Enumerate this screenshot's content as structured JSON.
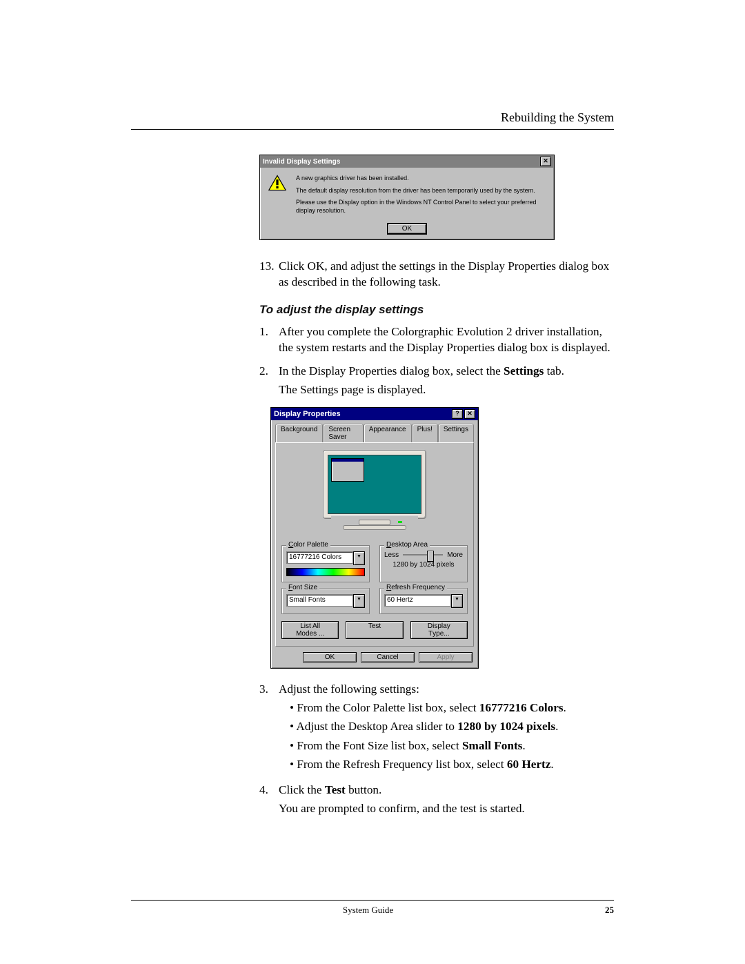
{
  "header": {
    "chapter": "Rebuilding the System"
  },
  "msgbox": {
    "title": "Invalid Display Settings",
    "line1": "A new graphics driver has been installed.",
    "line2": "The default display resolution from the driver has been temporarily used by the system.",
    "line3": "Please use the Display option in the Windows NT Control Panel to select your preferred display resolution.",
    "ok": "OK",
    "close": "✕"
  },
  "step13_num": "13.",
  "step13": "Click OK, and adjust the settings in the Display Properties dialog box as described in the following task.",
  "subhead": "To adjust the display settings",
  "step1_num": "1.",
  "step1": "After you complete the Colorgraphic Evolution 2 driver installation, the system restarts and the Display Properties dialog box is displayed.",
  "step2_num": "2.",
  "step2a": "In the Display Properties dialog box, select the ",
  "step2b": "Settings",
  "step2c": " tab.",
  "step2d": "The Settings page is displayed.",
  "dp": {
    "title": "Display Properties",
    "help": "?",
    "close": "✕",
    "tabs": {
      "background": "Background",
      "screensaver": "Screen Saver",
      "appearance": "Appearance",
      "plus": "Plus!",
      "settings": "Settings"
    },
    "color_palette_label": "Color Palette",
    "color_palette_label_ul": "C",
    "color_palette_value": "16777216 Colors",
    "desktop_area_label": "Desktop Area",
    "desktop_area_label_ul": "D",
    "less": "Less",
    "more": "More",
    "resolution": "1280 by 1024 pixels",
    "font_size_label": "Font Size",
    "font_size_label_ul": "F",
    "font_size_value": "Small Fonts",
    "refresh_label": "Refresh Frequency",
    "refresh_label_ul": "R",
    "refresh_value": "60 Hertz",
    "list_all": "List All Modes ...",
    "list_all_ul": "L",
    "test": "Test",
    "test_ul": "e",
    "display_type": "Display Type...",
    "display_type_ul": "T",
    "ok": "OK",
    "cancel": "Cancel",
    "apply": "Apply"
  },
  "step3_num": "3.",
  "step3": "Adjust the following settings:",
  "bullet1a": "From the Color Palette list box, select ",
  "bullet1b": "16777216 Colors",
  "bullet2a": "Adjust the Desktop Area slider to ",
  "bullet2b": "1280 by 1024 pixels",
  "bullet3a": "From the Font Size list box, select ",
  "bullet3b": "Small Fonts",
  "bullet4a": "From the Refresh Frequency list box, select ",
  "bullet4b": "60 Hertz",
  "step4_num": "4.",
  "step4a": "Click the ",
  "step4b": "Test",
  "step4c": " button.",
  "step4d": "You are prompted to confirm, and the test is started.",
  "footer": {
    "center": "System Guide",
    "right": "25"
  }
}
